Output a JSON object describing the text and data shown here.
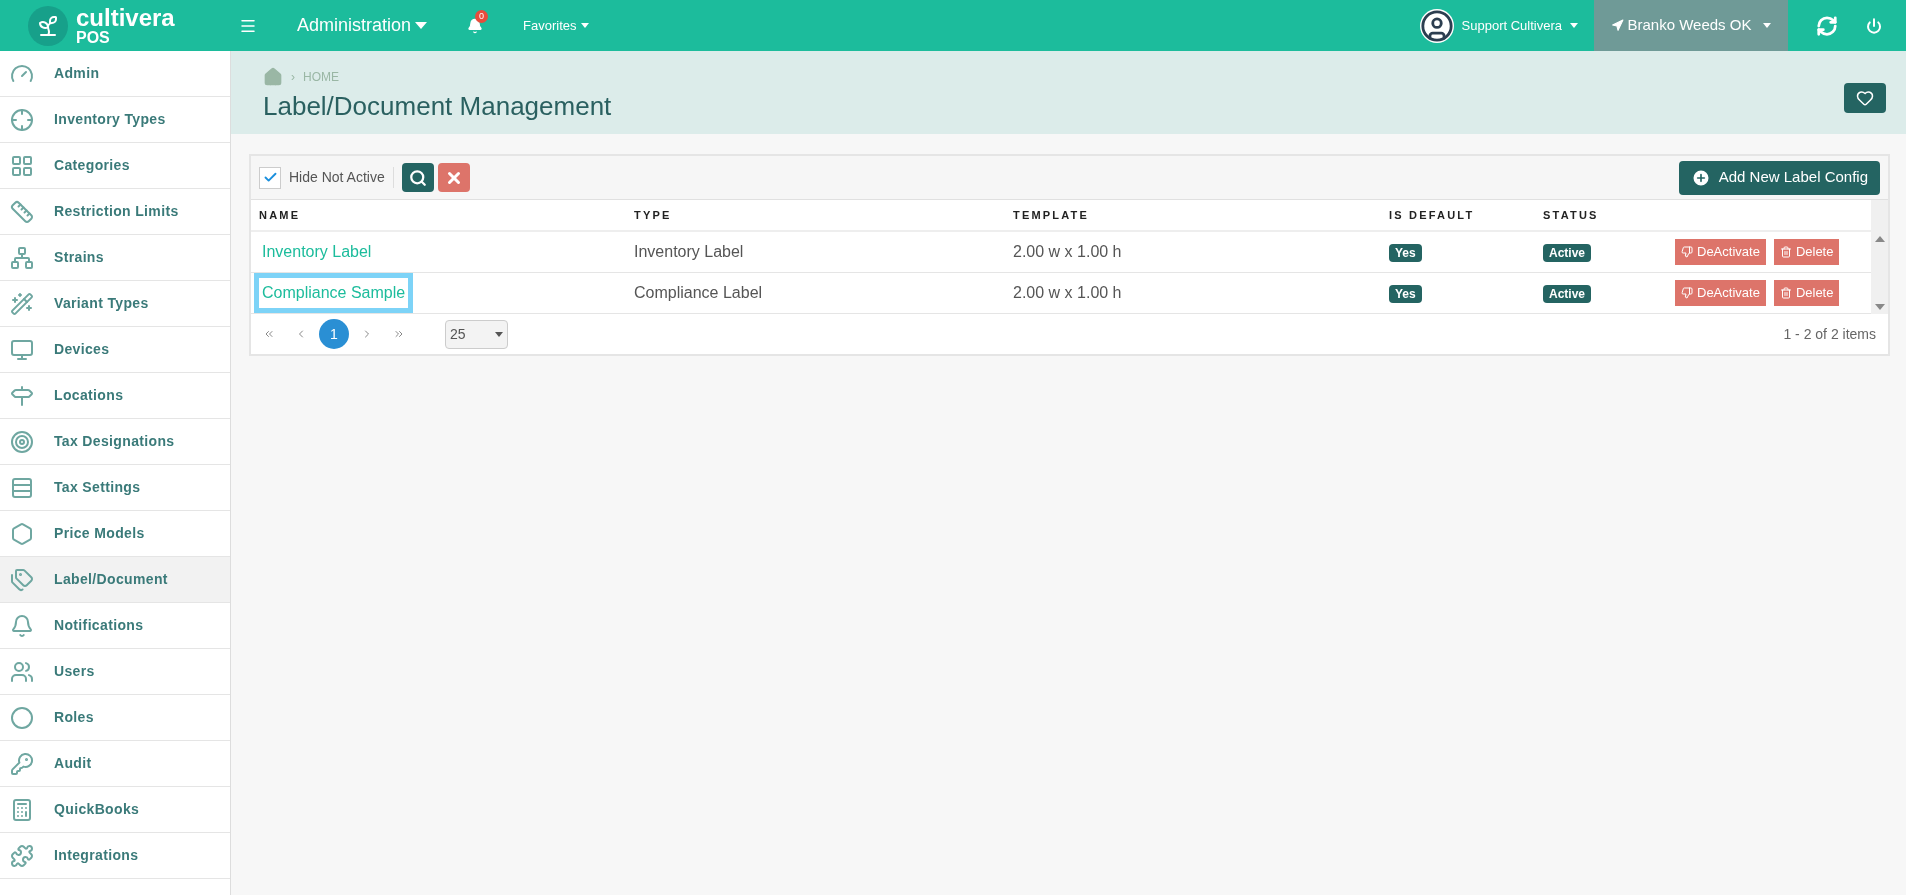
{
  "topbar": {
    "logo_name": "cultivera",
    "logo_sub": "POS",
    "menu": "Administration",
    "notifications": "0",
    "favorites": "Favorites",
    "user": "Support Cultivera",
    "location": "Branko Weeds OK"
  },
  "sidebar": {
    "items": [
      {
        "label": "Admin",
        "selected": false
      },
      {
        "label": "Inventory Types",
        "selected": false
      },
      {
        "label": "Categories",
        "selected": false
      },
      {
        "label": "Restriction Limits",
        "selected": false
      },
      {
        "label": "Strains",
        "selected": false
      },
      {
        "label": "Variant Types",
        "selected": false
      },
      {
        "label": "Devices",
        "selected": false
      },
      {
        "label": "Locations",
        "selected": false
      },
      {
        "label": "Tax Designations",
        "selected": false
      },
      {
        "label": "Tax Settings",
        "selected": false
      },
      {
        "label": "Price Models",
        "selected": false
      },
      {
        "label": "Label/Document",
        "selected": true
      },
      {
        "label": "Notifications",
        "selected": false
      },
      {
        "label": "Users",
        "selected": false
      },
      {
        "label": "Roles",
        "selected": false
      },
      {
        "label": "Audit",
        "selected": false
      },
      {
        "label": "QuickBooks",
        "selected": false
      },
      {
        "label": "Integrations",
        "selected": false
      }
    ]
  },
  "header": {
    "breadcrumb": "HOME",
    "breadcrumb_sep": "›",
    "title": "Label/Document Management"
  },
  "toolbar": {
    "filter": {
      "label": "Hide Not Active",
      "checked": true
    },
    "add_button": "Add New Label Config"
  },
  "table": {
    "columns": [
      "NAME",
      "TYPE",
      "TEMPLATE",
      "IS DEFAULT",
      "STATUS"
    ],
    "rows": [
      {
        "name": "Inventory Label",
        "type": "Inventory Label",
        "template": "2.00 w x 1.00 h",
        "is_default": "Yes",
        "status": "Active",
        "deactivate": "DeActivate",
        "delete": "Delete",
        "highlighted": false
      },
      {
        "name": "Compliance Sample",
        "type": "Compliance Label",
        "template": "2.00 w x 1.00 h",
        "is_default": "Yes",
        "status": "Active",
        "deactivate": "DeActivate",
        "delete": "Delete",
        "highlighted": true
      }
    ]
  },
  "pager": {
    "pages": [
      {
        "label": "1",
        "selected": true
      }
    ],
    "page_size": "25",
    "summary": "1 - 2 of 2 items"
  }
}
